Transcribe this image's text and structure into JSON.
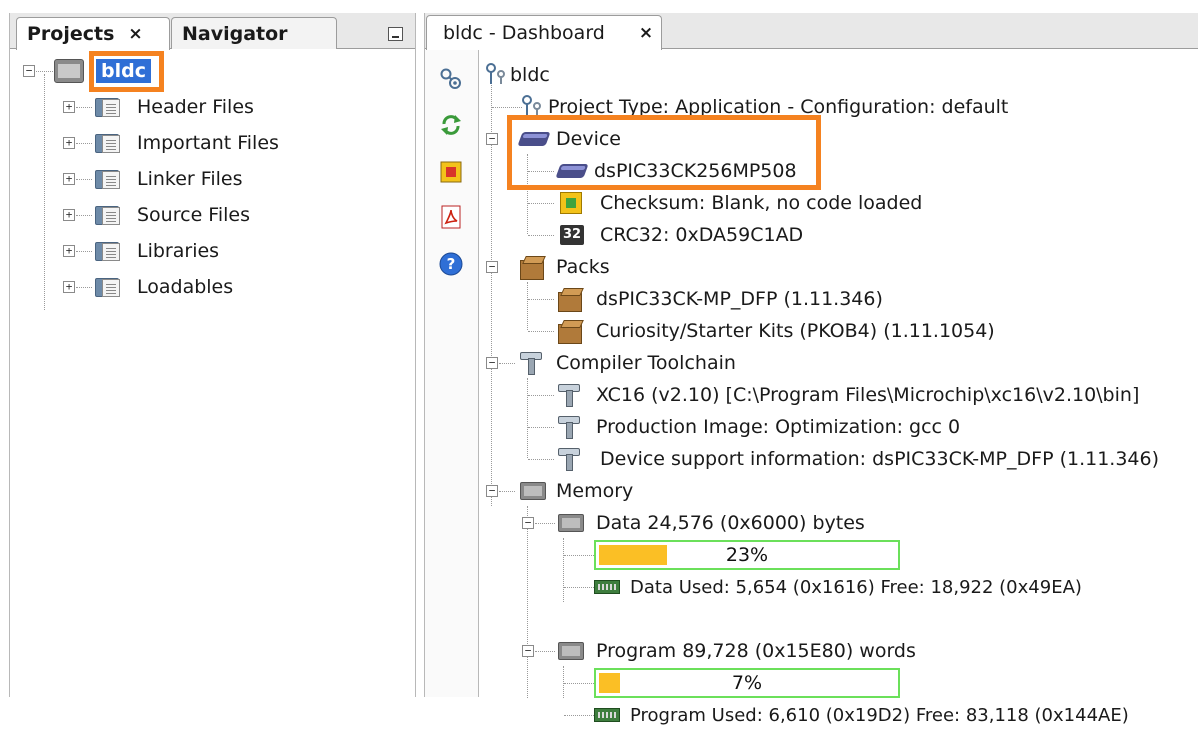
{
  "projects_panel": {
    "tabs": [
      {
        "label": "Projects",
        "close": "×",
        "active": true
      },
      {
        "label": "Navigator",
        "active": false
      }
    ],
    "root": "bldc",
    "items": [
      "Header Files",
      "Important Files",
      "Linker Files",
      "Source Files",
      "Libraries",
      "Loadables"
    ]
  },
  "dashboard": {
    "tab": {
      "label": "bldc - Dashboard",
      "close": "×"
    },
    "tools": [
      "settings-icon",
      "refresh-icon",
      "stop-icon",
      "pdf-icon",
      "help-icon"
    ],
    "root": "bldc",
    "project_type": "Project Type: Application - Configuration: default",
    "device": {
      "label": "Device",
      "name": "dsPIC33CK256MP508",
      "checksum": "Checksum: Blank, no code loaded",
      "crc_badge": "32",
      "crc": "CRC32: 0xDA59C1AD"
    },
    "packs": {
      "label": "Packs",
      "items": [
        "dsPIC33CK-MP_DFP (1.11.346)",
        "Curiosity/Starter Kits (PKOB4) (1.11.1054)"
      ]
    },
    "toolchain": {
      "label": "Compiler Toolchain",
      "items": [
        "XC16 (v2.10) [C:\\Program Files\\Microchip\\xc16\\v2.10\\bin]",
        "Production Image: Optimization: gcc 0",
        "Device support information: dsPIC33CK-MP_DFP (1.11.346)"
      ]
    },
    "memory": {
      "label": "Memory",
      "data": {
        "label": "Data 24,576 (0x6000) bytes",
        "percent_label": "23%",
        "percent": 23,
        "used": "Data Used: 5,654 (0x1616) Free: 18,922 (0x49EA)"
      },
      "program": {
        "label": "Program 89,728 (0x15E80) words",
        "percent_label": "7%",
        "percent": 7,
        "used": "Program Used: 6,610 (0x19D2) Free: 83,118 (0x144AE)"
      }
    }
  },
  "colors": {
    "highlight": "#f58220",
    "bar_fill": "#fbbf25",
    "bar_border": "#6be05a",
    "selection": "#2f6fd6"
  }
}
